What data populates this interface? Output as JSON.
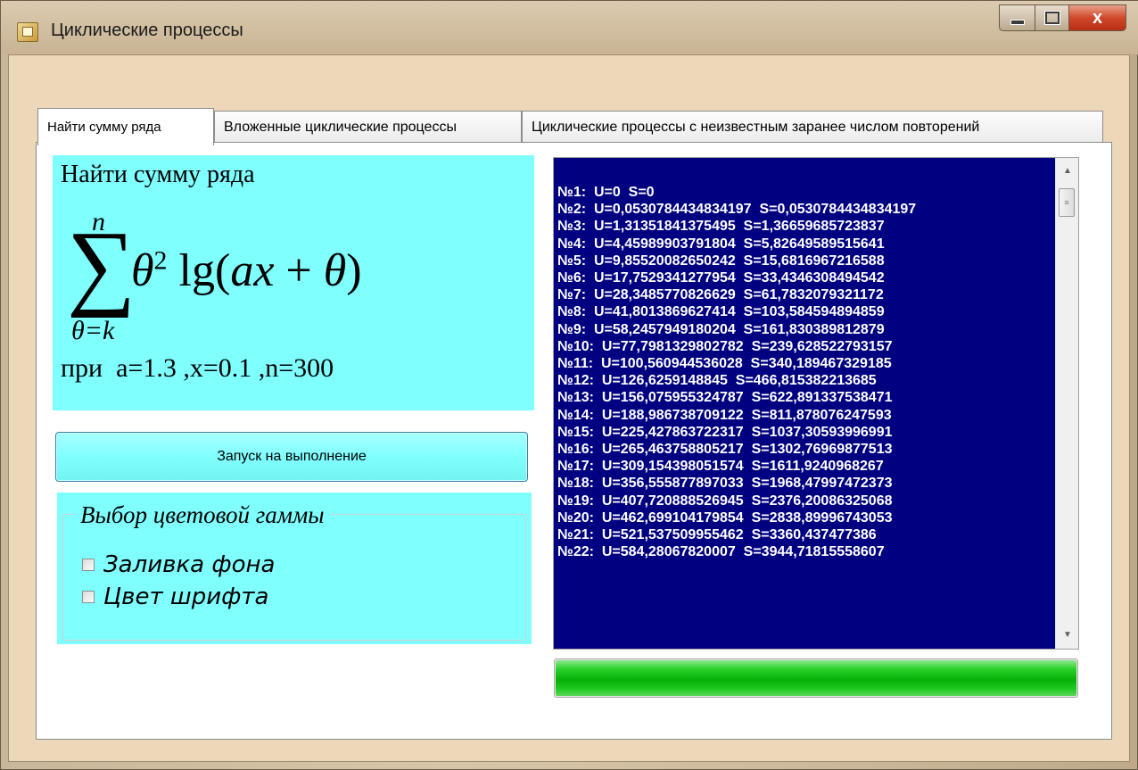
{
  "window": {
    "title": "Циклические процессы",
    "close_glyph": "x"
  },
  "tabs": [
    {
      "label": "Найти сумму ряда",
      "active": true
    },
    {
      "label": "Вложенные циклические процессы",
      "active": false
    },
    {
      "label": "Циклические процессы с неизвестным заранее числом повторений",
      "active": false
    }
  ],
  "formula": {
    "title": "Найти сумму ряда",
    "upper_limit": "n",
    "sigma": "∑",
    "lower_limit": "θ=k",
    "params": "при  a=1.3 ,x=0.1 ,n=300"
  },
  "run_button": {
    "label": "Запуск на выполнение"
  },
  "color_group": {
    "legend": "Выбор цветовой гаммы",
    "options": [
      {
        "label": "Заливка фона",
        "checked": false
      },
      {
        "label": "Цвет шрифта",
        "checked": false
      }
    ]
  },
  "output": {
    "lines": [
      "№1:  U=0  S=0",
      "№2:  U=0,0530784434834197  S=0,0530784434834197",
      "№3:  U=1,31351841375495  S=1,36659685723837",
      "№4:  U=4,45989903791804  S=5,82649589515641",
      "№5:  U=9,85520082650242  S=15,6816967216588",
      "№6:  U=17,7529341277954  S=33,4346308494542",
      "№7:  U=28,3485770826629  S=61,7832079321172",
      "№8:  U=41,8013869627414  S=103,584594894859",
      "№9:  U=58,2457949180204  S=161,830389812879",
      "№10:  U=77,7981329802782  S=239,628522793157",
      "№11:  U=100,560944536028  S=340,189467329185",
      "№12:  U=126,6259148845  S=466,815382213685",
      "№13:  U=156,075955324787  S=622,891337538471",
      "№14:  U=188,986738709122  S=811,878076247593",
      "№15:  U=225,427863722317  S=1037,30593996991",
      "№16:  U=265,463758805217  S=1302,76969877513",
      "№17:  U=309,154398051574  S=1611,9240968267",
      "№18:  U=356,555877897033  S=1968,47997472373",
      "№19:  U=407,720888526945  S=2376,20086325068",
      "№20:  U=462,699104179854  S=2838,89996743053",
      "№21:  U=521,537509955462  S=3360,437477386",
      "№22:  U=584,28067820007  S=3944,71815558607"
    ]
  },
  "progress": {
    "value": 1.0
  },
  "colors": {
    "panel_cyan": "#80ffff",
    "listbox_navy": "#000080",
    "progress_green": "#06b006"
  },
  "icons": {
    "app": "app-window-icon",
    "minimize": "minimize-icon",
    "maximize": "maximize-icon",
    "close": "close-icon",
    "scroll_up": "chevron-up-icon",
    "scroll_down": "chevron-down-icon",
    "scroll_grip": "grip-icon"
  }
}
